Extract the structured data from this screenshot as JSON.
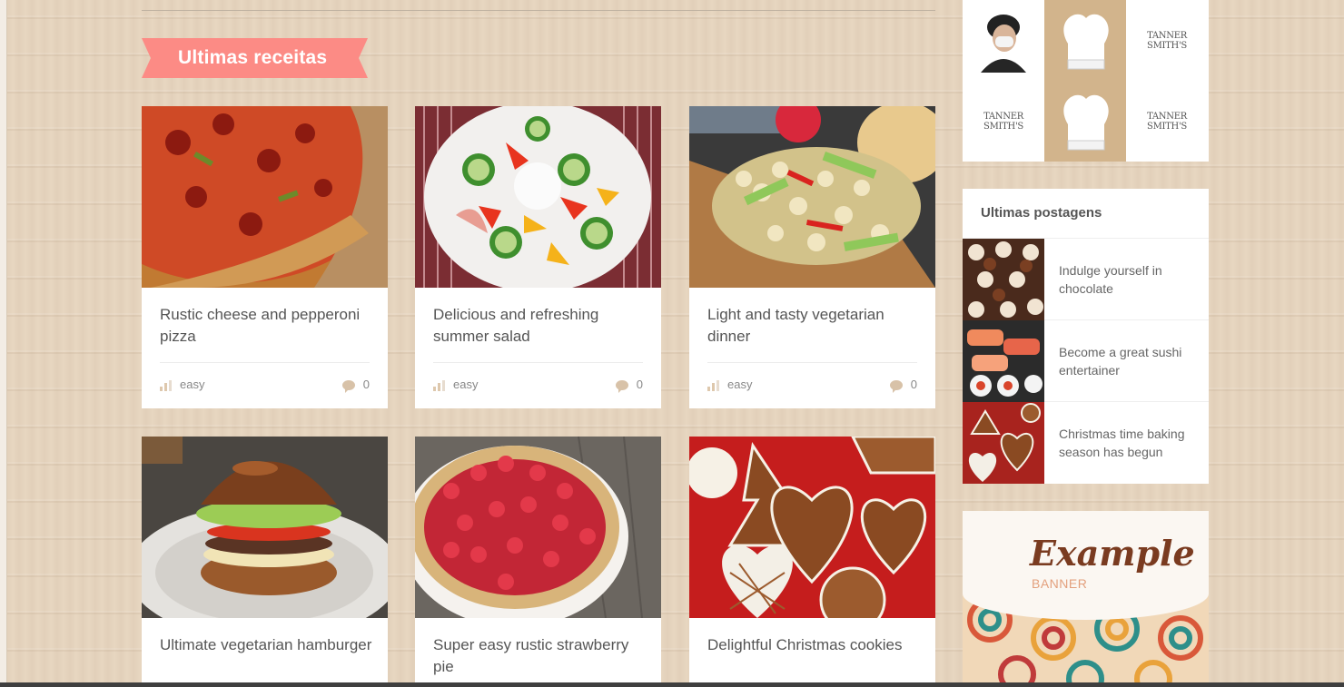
{
  "section": {
    "title": "Ultimas receitas"
  },
  "recipes": [
    {
      "title": "Rustic cheese and pepperoni pizza",
      "difficulty": "easy",
      "comments": "0"
    },
    {
      "title": "Delicious and refreshing summer salad",
      "difficulty": "easy",
      "comments": "0"
    },
    {
      "title": "Light and tasty vegetarian dinner",
      "difficulty": "easy",
      "comments": "0"
    },
    {
      "title": "Ultimate vegetarian hamburger"
    },
    {
      "title": "Super easy rustic strawberry pie"
    },
    {
      "title": "Delightful Christmas cookies"
    }
  ],
  "sidebar": {
    "chef_grid": {
      "logo_text": "TANNER SMITH'S"
    },
    "latest_posts": {
      "title": "Ultimas postagens",
      "items": [
        {
          "title": "Indulge yourself in chocolate"
        },
        {
          "title": "Become a great sushi entertainer"
        },
        {
          "title": "Christmas time baking season has begun"
        }
      ]
    },
    "banner": {
      "title": "Example",
      "subtitle": "BANNER"
    }
  },
  "colors": {
    "accent": "#fc8b85",
    "tan": "#d2b48c",
    "text": "#555555"
  }
}
